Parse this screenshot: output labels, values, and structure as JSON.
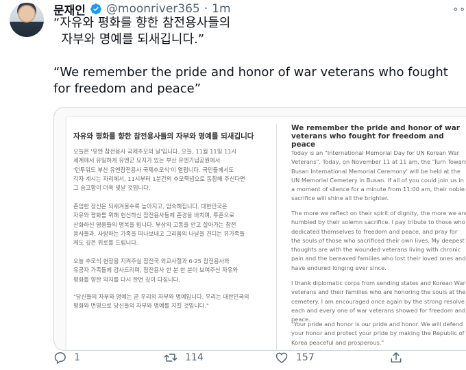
{
  "tweet": {
    "author_name": "문재인",
    "handle": "@moonriver365",
    "separator": "·",
    "time": "1m",
    "more": "∘∘",
    "text_ko": "“자유와 평화를 향한 참전용사들의\n  자부와 명예를 되새깁니다.”",
    "text_en": "“We remember the pride and honor of war veterans who fought for freedom and peace”"
  },
  "doc": {
    "ko_title": "자유와 평화를 향한 참전용사들의 자부와 명예를 되새깁니다",
    "ko_p1": "오늘은 '유엔 참전용사 국제추모의 날'입니다. 오늘, 11월 11일 11시\n세계에서 유일하게 유엔군 묘지가 있는 부산 유엔기념공원에서\n'턴투워드 부산 유엔참전용사 국제추모식'이 열립니다. 국민들께서도\n각자 계시는 자리에서, 11시부터 1분간의 추모묵념으로 동참해 주신다면\n그 숭고함이 더욱 빛날 것입니다.",
    "ko_p2": "존엄한 정신은 되새겨볼수록 높아지고, 엄숙해집니다. 대한민국은\n자유와 평화를 위해 헌신하신 참전용사들께 존경을 바치며, 투혼으로\n산화하신 영웅들의 명복을 빕니다. 부상의 고통을 안고 살아가는 참전\n용사들과, 사랑하는 가족을 떠나보내고 그리움의 나날을 견디는 유가족들\n께도 깊은 위로를 드립니다.",
    "ko_p3": "오늘 추모식 현장을 지켜주실 참전국 외교사절과 6·25 참전용사와\n유공자 가족들께 감사드리며, 참전용사 한 분 한 분이 보여주신 자유와\n평화를 향한 의지를 다시 한번 깊이 다짐니다.",
    "ko_p4": "\"당신들의 자부와 명예는 곧 우리의 자부와 명예입니다. 우리는 대한민국의\n평화와 번영으로 당신들의 자부와 명예를 지킬 것입니다.\"",
    "en_title": "We remember the pride and honor of war veterans who fought for freedom and peace",
    "en_p1": "Today is an \"International Memorial Day for UN Korean War Veterans\". Today, on November 11 at 11 am, the 'Turn Toward Busan International Memorial Ceremony' will be held at the UN Memorial Cemetery in Busan. If all of you could join us in a moment of silence for a minute from 11:00 am, their noble sacrifice will shine all the brighter.",
    "en_p2": "The more we reflect on their spirit of dignity, the more we are humbled by their solemn sacrifice. I pay tribute to those who dedicated themselves to freedom and peace, and pray for the souls of those who sacrificed their own lives. My deepest thoughts are with the wounded veterans living with chronic pain and the bereaved families who lost their loved ones and have endured longing ever since.",
    "en_p3": "I thank diplomatic corps from sending states and Korean War veterans and their families who are honoring the souls at the cemetery. I am encouraged once again by the strong resolve each and every one of war veterans showed for freedom and peace.",
    "en_p4": "\"Your pride and honor is our pride and honor. We will defend your honor and protect your pride by making the Republic of Korea peaceful and prosperous.\""
  },
  "actions": {
    "reply_count": "1",
    "retweet_count": "114",
    "like_count": "157"
  },
  "colors": {
    "verified": "#1d9bf0",
    "muted": "#536471"
  }
}
